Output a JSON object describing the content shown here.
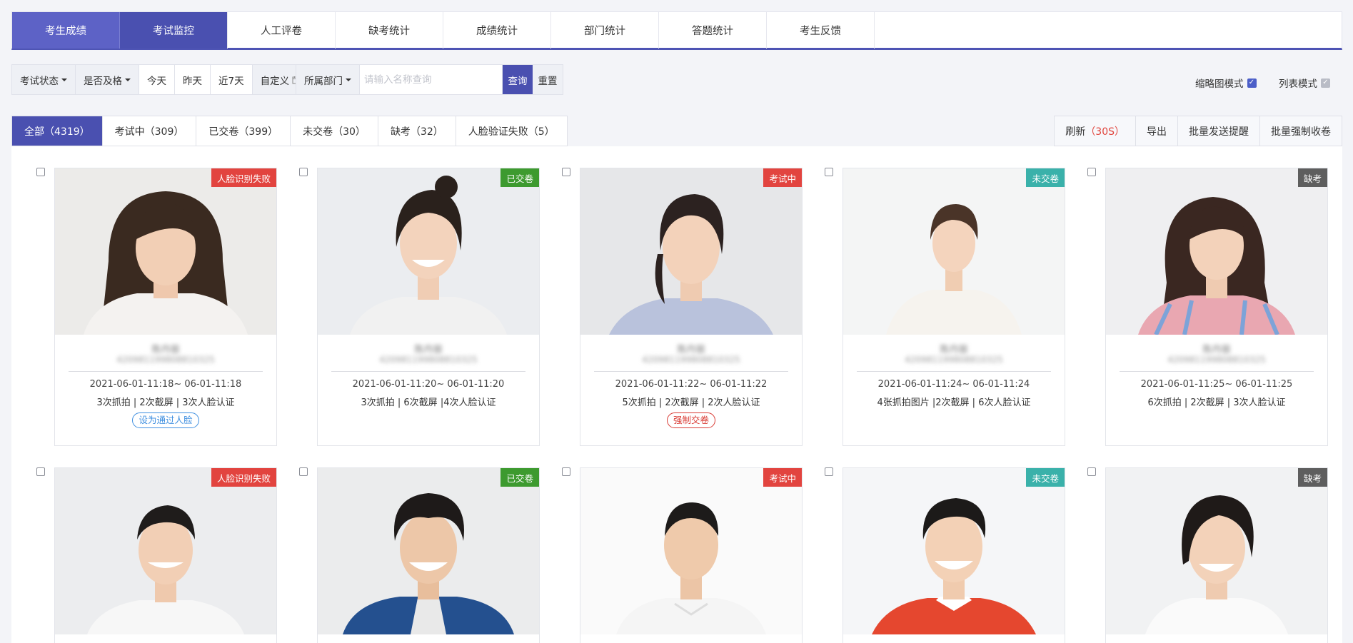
{
  "top_tabs": [
    "考生成绩",
    "考试监控",
    "人工评卷",
    "缺考统计",
    "成绩统计",
    "部门统计",
    "答题统计",
    "考生反馈"
  ],
  "filters": {
    "exam_status": "考试状态",
    "passed": "是否及格",
    "today": "今天",
    "yesterday": "昨天",
    "last7": "近7天",
    "custom": "自定义",
    "department": "所属部门",
    "search_placeholder": "请输入名称查询",
    "query": "查询",
    "reset": "重置"
  },
  "view_modes": {
    "thumbnail": "缩略图模式",
    "list": "列表模式"
  },
  "status_tabs": [
    "全部（4319）",
    "考试中（309）",
    "已交卷（399）",
    "未交卷（30）",
    "缺考（32）",
    "人脸验证失败（5）"
  ],
  "actions": {
    "refresh": "刷新",
    "refresh_count": "（30S）",
    "export": "导出",
    "batch_remind": "批量发送提醒",
    "batch_collect": "批量强制收卷"
  },
  "colors": {
    "primary": "#4a50b0",
    "fail": "#e2443f",
    "submitted": "#3d9a2f",
    "not_submitted": "#3ab1aa",
    "absent": "#5e5e5e"
  },
  "cards": [
    {
      "badge": "人脸识别失败",
      "name": "陈丹丽",
      "id": "420981199808810325",
      "time": "2021-06-01-11:18~ 06-01-11:18",
      "stats": "3次抓拍 |  2次截屏 |  3次人脸认证",
      "action": "设为通过人脸"
    },
    {
      "badge": "已交卷",
      "name": "陈丹丽",
      "id": "420981199808810325",
      "time": "2021-06-01-11:20~ 06-01-11:20",
      "stats": "3次抓拍 |  6次截屏  |4次人脸认证",
      "action": ""
    },
    {
      "badge": "考试中",
      "name": "陈丹丽",
      "id": "420981199808810325",
      "time": "2021-06-01-11:22~ 06-01-11:22",
      "stats": "5次抓拍 |  2次截屏  |  2次人脸认证",
      "action": "强制交卷"
    },
    {
      "badge": "未交卷",
      "name": "陈丹丽",
      "id": "420981199808810325",
      "time": "2021-06-01-11:24~ 06-01-11:24",
      "stats": "4张抓拍图片 |2次截屏 | 6次人脸认证",
      "action": ""
    },
    {
      "badge": "缺考",
      "name": "陈丹丽",
      "id": "420981199808810325",
      "time": "2021-06-01-11:25~ 06-01-11:25",
      "stats": "6次抓拍 |  2次截屏  | 3次人脸认证",
      "action": ""
    },
    {
      "badge": "人脸识别失败"
    },
    {
      "badge": "已交卷"
    },
    {
      "badge": "考试中"
    },
    {
      "badge": "未交卷"
    },
    {
      "badge": "缺考"
    }
  ]
}
